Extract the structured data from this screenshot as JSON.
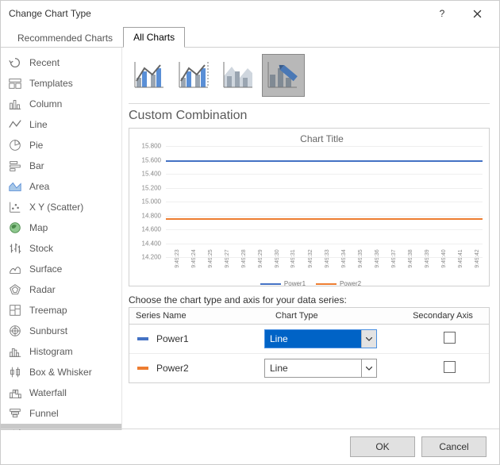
{
  "window": {
    "title": "Change Chart Type"
  },
  "tabs": [
    {
      "label": "Recommended Charts",
      "active": false
    },
    {
      "label": "All Charts",
      "active": true
    }
  ],
  "sidebar": {
    "items": [
      {
        "label": "Recent"
      },
      {
        "label": "Templates"
      },
      {
        "label": "Column"
      },
      {
        "label": "Line"
      },
      {
        "label": "Pie"
      },
      {
        "label": "Bar"
      },
      {
        "label": "Area"
      },
      {
        "label": "X Y (Scatter)"
      },
      {
        "label": "Map"
      },
      {
        "label": "Stock"
      },
      {
        "label": "Surface"
      },
      {
        "label": "Radar"
      },
      {
        "label": "Treemap"
      },
      {
        "label": "Sunburst"
      },
      {
        "label": "Histogram"
      },
      {
        "label": "Box & Whisker"
      },
      {
        "label": "Waterfall"
      },
      {
        "label": "Funnel"
      },
      {
        "label": "Combo"
      }
    ],
    "selected_index": 18
  },
  "subtitle": "Custom Combination",
  "preview": {
    "title": "Chart Title",
    "legend": [
      "Power1",
      "Power2"
    ]
  },
  "chart_data": {
    "type": "line",
    "categories": [
      "9:49:23",
      "9:49:24",
      "9:49:25",
      "9:49:27",
      "9:49:28",
      "9:49:29",
      "9:49:30",
      "9:49:31",
      "9:49:32",
      "9:49:33",
      "9:49:34",
      "9:49:35",
      "9:49:36",
      "9:49:37",
      "9:49:38",
      "9:49:39",
      "9:49:40",
      "9:49:41",
      "9:49:42"
    ],
    "series": [
      {
        "name": "Power1",
        "color": "#4472c4",
        "values": [
          15.58,
          15.6,
          15.6,
          15.6,
          15.6,
          15.6,
          15.6,
          15.6,
          15.6,
          15.6,
          15.6,
          15.6,
          15.6,
          15.6,
          15.6,
          15.6,
          15.6,
          15.6,
          15.6
        ]
      },
      {
        "name": "Power2",
        "color": "#ed7d31",
        "values": [
          14.78,
          14.76,
          14.76,
          14.76,
          14.76,
          14.76,
          14.76,
          14.76,
          14.76,
          14.76,
          14.76,
          14.76,
          14.76,
          14.76,
          14.76,
          14.76,
          14.76,
          14.76,
          14.76
        ]
      }
    ],
    "yticks": [
      14.2,
      14.4,
      14.6,
      14.8,
      15.0,
      15.2,
      15.4,
      15.6,
      15.8
    ],
    "ylim": [
      14.2,
      15.8
    ],
    "title": "Chart Title"
  },
  "series_grid": {
    "prompt": "Choose the chart type and axis for your data series:",
    "headers": {
      "name": "Series Name",
      "type": "Chart Type",
      "secondary": "Secondary Axis"
    },
    "rows": [
      {
        "name": "Power1",
        "color": "#4472c4",
        "type": "Line",
        "secondary": false,
        "active": true
      },
      {
        "name": "Power2",
        "color": "#ed7d31",
        "type": "Line",
        "secondary": false,
        "active": false
      }
    ]
  },
  "footer": {
    "ok": "OK",
    "cancel": "Cancel"
  }
}
